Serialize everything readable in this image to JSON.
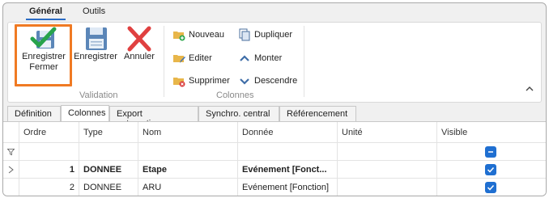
{
  "ribbon_tabs": [
    {
      "label": "Général",
      "active": true
    },
    {
      "label": "Outils",
      "active": false
    }
  ],
  "validation": {
    "group_label": "Validation",
    "save_close_label_line1": "Enregistrer",
    "save_close_label_line2": "Fermer",
    "save_label": "Enregistrer",
    "cancel_label": "Annuler"
  },
  "colonnes": {
    "group_label": "Colonnes",
    "new_label": "Nouveau",
    "edit_label": "Editer",
    "delete_label": "Supprimer",
    "duplicate_label": "Dupliquer",
    "up_label": "Monter",
    "down_label": "Descendre"
  },
  "sub_tabs": [
    {
      "label": "Définition",
      "active": false
    },
    {
      "label": "Colonnes",
      "active": true
    },
    {
      "label": "Export automatique",
      "active": false
    },
    {
      "label": "Synchro. central",
      "active": false
    },
    {
      "label": "Référencement",
      "active": false
    }
  ],
  "grid": {
    "columns": [
      "Ordre",
      "Type",
      "Nom",
      "Donnée",
      "Unité",
      "Visible"
    ],
    "rows": [
      {
        "ordre": "1",
        "type": "DONNEE",
        "nom": "Etape",
        "donnee": "Evénement [Fonct...",
        "unite": "",
        "visible": true,
        "bold": true
      },
      {
        "ordre": "2",
        "type": "DONNEE",
        "nom": "ARU",
        "donnee": "Evénement [Fonction]",
        "unite": "",
        "visible": true,
        "bold": false
      }
    ]
  },
  "colors": {
    "accent": "#2b6cc4",
    "highlight": "#f07a23",
    "checkbox": "#1f6fd1"
  }
}
